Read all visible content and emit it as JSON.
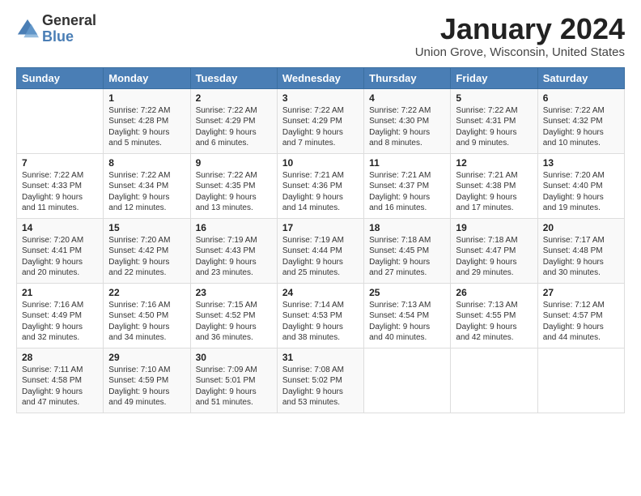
{
  "logo": {
    "general": "General",
    "blue": "Blue"
  },
  "header": {
    "month": "January 2024",
    "location": "Union Grove, Wisconsin, United States"
  },
  "weekdays": [
    "Sunday",
    "Monday",
    "Tuesday",
    "Wednesday",
    "Thursday",
    "Friday",
    "Saturday"
  ],
  "weeks": [
    [
      {
        "day": "",
        "sunrise": "",
        "sunset": "",
        "daylight": ""
      },
      {
        "day": "1",
        "sunrise": "Sunrise: 7:22 AM",
        "sunset": "Sunset: 4:28 PM",
        "daylight": "Daylight: 9 hours and 5 minutes."
      },
      {
        "day": "2",
        "sunrise": "Sunrise: 7:22 AM",
        "sunset": "Sunset: 4:29 PM",
        "daylight": "Daylight: 9 hours and 6 minutes."
      },
      {
        "day": "3",
        "sunrise": "Sunrise: 7:22 AM",
        "sunset": "Sunset: 4:29 PM",
        "daylight": "Daylight: 9 hours and 7 minutes."
      },
      {
        "day": "4",
        "sunrise": "Sunrise: 7:22 AM",
        "sunset": "Sunset: 4:30 PM",
        "daylight": "Daylight: 9 hours and 8 minutes."
      },
      {
        "day": "5",
        "sunrise": "Sunrise: 7:22 AM",
        "sunset": "Sunset: 4:31 PM",
        "daylight": "Daylight: 9 hours and 9 minutes."
      },
      {
        "day": "6",
        "sunrise": "Sunrise: 7:22 AM",
        "sunset": "Sunset: 4:32 PM",
        "daylight": "Daylight: 9 hours and 10 minutes."
      }
    ],
    [
      {
        "day": "7",
        "sunrise": "Sunrise: 7:22 AM",
        "sunset": "Sunset: 4:33 PM",
        "daylight": "Daylight: 9 hours and 11 minutes."
      },
      {
        "day": "8",
        "sunrise": "Sunrise: 7:22 AM",
        "sunset": "Sunset: 4:34 PM",
        "daylight": "Daylight: 9 hours and 12 minutes."
      },
      {
        "day": "9",
        "sunrise": "Sunrise: 7:22 AM",
        "sunset": "Sunset: 4:35 PM",
        "daylight": "Daylight: 9 hours and 13 minutes."
      },
      {
        "day": "10",
        "sunrise": "Sunrise: 7:21 AM",
        "sunset": "Sunset: 4:36 PM",
        "daylight": "Daylight: 9 hours and 14 minutes."
      },
      {
        "day": "11",
        "sunrise": "Sunrise: 7:21 AM",
        "sunset": "Sunset: 4:37 PM",
        "daylight": "Daylight: 9 hours and 16 minutes."
      },
      {
        "day": "12",
        "sunrise": "Sunrise: 7:21 AM",
        "sunset": "Sunset: 4:38 PM",
        "daylight": "Daylight: 9 hours and 17 minutes."
      },
      {
        "day": "13",
        "sunrise": "Sunrise: 7:20 AM",
        "sunset": "Sunset: 4:40 PM",
        "daylight": "Daylight: 9 hours and 19 minutes."
      }
    ],
    [
      {
        "day": "14",
        "sunrise": "Sunrise: 7:20 AM",
        "sunset": "Sunset: 4:41 PM",
        "daylight": "Daylight: 9 hours and 20 minutes."
      },
      {
        "day": "15",
        "sunrise": "Sunrise: 7:20 AM",
        "sunset": "Sunset: 4:42 PM",
        "daylight": "Daylight: 9 hours and 22 minutes."
      },
      {
        "day": "16",
        "sunrise": "Sunrise: 7:19 AM",
        "sunset": "Sunset: 4:43 PM",
        "daylight": "Daylight: 9 hours and 23 minutes."
      },
      {
        "day": "17",
        "sunrise": "Sunrise: 7:19 AM",
        "sunset": "Sunset: 4:44 PM",
        "daylight": "Daylight: 9 hours and 25 minutes."
      },
      {
        "day": "18",
        "sunrise": "Sunrise: 7:18 AM",
        "sunset": "Sunset: 4:45 PM",
        "daylight": "Daylight: 9 hours and 27 minutes."
      },
      {
        "day": "19",
        "sunrise": "Sunrise: 7:18 AM",
        "sunset": "Sunset: 4:47 PM",
        "daylight": "Daylight: 9 hours and 29 minutes."
      },
      {
        "day": "20",
        "sunrise": "Sunrise: 7:17 AM",
        "sunset": "Sunset: 4:48 PM",
        "daylight": "Daylight: 9 hours and 30 minutes."
      }
    ],
    [
      {
        "day": "21",
        "sunrise": "Sunrise: 7:16 AM",
        "sunset": "Sunset: 4:49 PM",
        "daylight": "Daylight: 9 hours and 32 minutes."
      },
      {
        "day": "22",
        "sunrise": "Sunrise: 7:16 AM",
        "sunset": "Sunset: 4:50 PM",
        "daylight": "Daylight: 9 hours and 34 minutes."
      },
      {
        "day": "23",
        "sunrise": "Sunrise: 7:15 AM",
        "sunset": "Sunset: 4:52 PM",
        "daylight": "Daylight: 9 hours and 36 minutes."
      },
      {
        "day": "24",
        "sunrise": "Sunrise: 7:14 AM",
        "sunset": "Sunset: 4:53 PM",
        "daylight": "Daylight: 9 hours and 38 minutes."
      },
      {
        "day": "25",
        "sunrise": "Sunrise: 7:13 AM",
        "sunset": "Sunset: 4:54 PM",
        "daylight": "Daylight: 9 hours and 40 minutes."
      },
      {
        "day": "26",
        "sunrise": "Sunrise: 7:13 AM",
        "sunset": "Sunset: 4:55 PM",
        "daylight": "Daylight: 9 hours and 42 minutes."
      },
      {
        "day": "27",
        "sunrise": "Sunrise: 7:12 AM",
        "sunset": "Sunset: 4:57 PM",
        "daylight": "Daylight: 9 hours and 44 minutes."
      }
    ],
    [
      {
        "day": "28",
        "sunrise": "Sunrise: 7:11 AM",
        "sunset": "Sunset: 4:58 PM",
        "daylight": "Daylight: 9 hours and 47 minutes."
      },
      {
        "day": "29",
        "sunrise": "Sunrise: 7:10 AM",
        "sunset": "Sunset: 4:59 PM",
        "daylight": "Daylight: 9 hours and 49 minutes."
      },
      {
        "day": "30",
        "sunrise": "Sunrise: 7:09 AM",
        "sunset": "Sunset: 5:01 PM",
        "daylight": "Daylight: 9 hours and 51 minutes."
      },
      {
        "day": "31",
        "sunrise": "Sunrise: 7:08 AM",
        "sunset": "Sunset: 5:02 PM",
        "daylight": "Daylight: 9 hours and 53 minutes."
      },
      {
        "day": "",
        "sunrise": "",
        "sunset": "",
        "daylight": ""
      },
      {
        "day": "",
        "sunrise": "",
        "sunset": "",
        "daylight": ""
      },
      {
        "day": "",
        "sunrise": "",
        "sunset": "",
        "daylight": ""
      }
    ]
  ]
}
